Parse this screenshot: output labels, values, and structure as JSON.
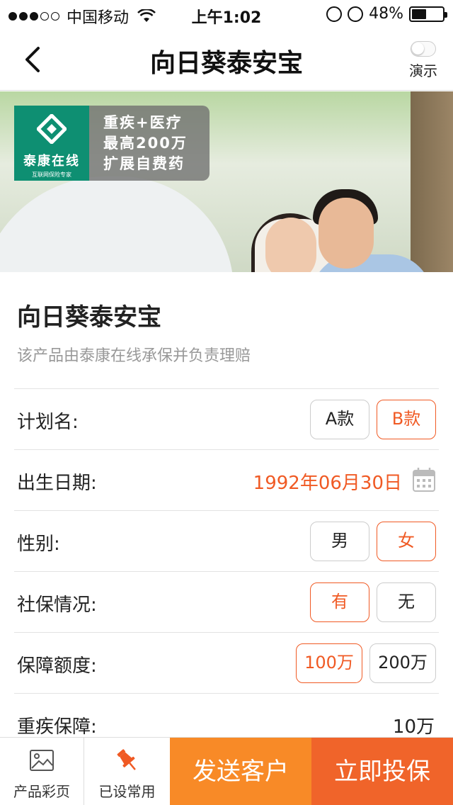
{
  "status_bar": {
    "carrier": "中国移动",
    "time": "上午1:02",
    "battery_text": "48%",
    "battery_level": 0.48,
    "signal_dots_filled": 3,
    "signal_dots_total": 5
  },
  "nav": {
    "title": "向日葵泰安宝",
    "demo_label": "演示",
    "demo_toggle_on": false
  },
  "banner": {
    "logo_name": "泰康在线",
    "logo_sub": "互联网保险专家",
    "lines": [
      "重疾+医疗",
      "最高200万",
      "扩展自费药"
    ]
  },
  "product": {
    "title": "向日葵泰安宝",
    "subtitle": "该产品由泰康在线承保并负责理赔"
  },
  "form": {
    "plan": {
      "label": "计划名:",
      "options": [
        "A款",
        "B款"
      ],
      "selected": "B款"
    },
    "birth": {
      "label": "出生日期:",
      "value": "1992年06月30日"
    },
    "gender": {
      "label": "性别:",
      "options": [
        "男",
        "女"
      ],
      "selected": "女"
    },
    "social": {
      "label": "社保情况:",
      "options": [
        "有",
        "无"
      ],
      "selected": "有"
    },
    "amount": {
      "label": "保障额度:",
      "options": [
        "100万",
        "200万"
      ],
      "selected": "100万"
    },
    "critical": {
      "label": "重疾保障:",
      "value": "10万"
    }
  },
  "bottom_bar": {
    "brochure_label": "产品彩页",
    "favorite_label": "已设常用",
    "send_label": "发送客户",
    "buy_label": "立即投保"
  },
  "colors": {
    "accent": "#f05a24",
    "send_button": "#f88a27",
    "buy_button": "#f0642a",
    "logo_green": "#0e8f72"
  }
}
